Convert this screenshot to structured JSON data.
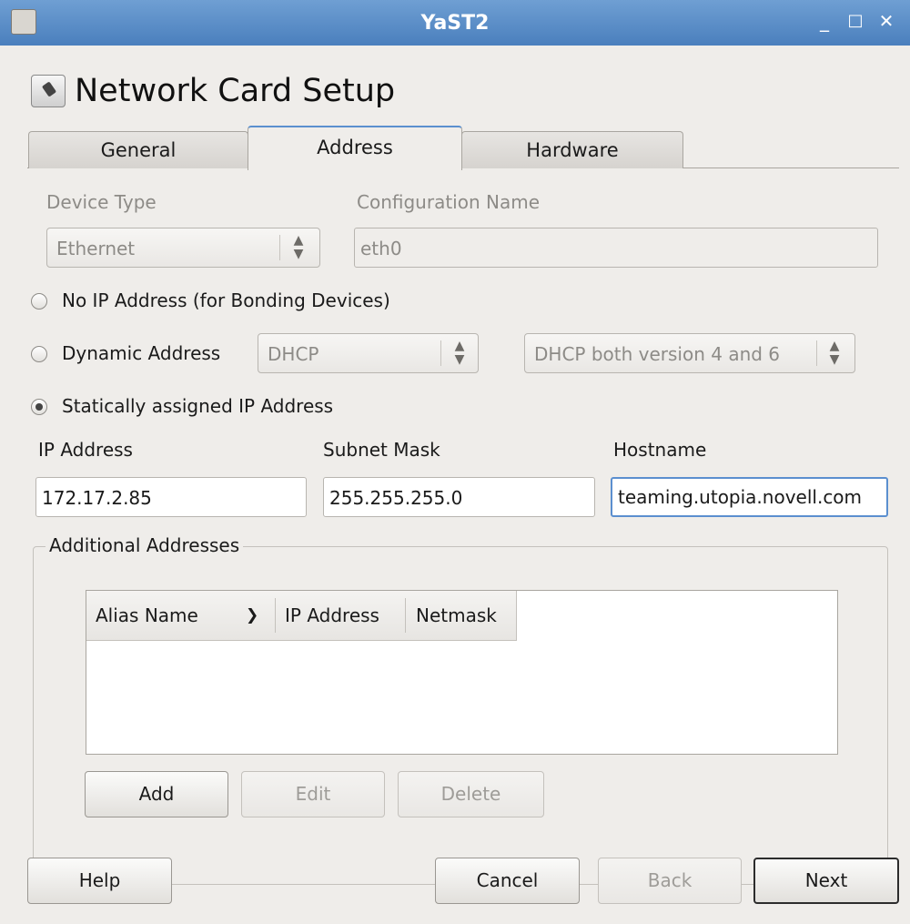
{
  "window": {
    "title": "YaST2",
    "minimize": "_",
    "maximize": "□",
    "close": "✕"
  },
  "page_title": "Network Card Setup",
  "tabs": [
    {
      "label": "General"
    },
    {
      "label": "Address",
      "active": true
    },
    {
      "label": "Hardware"
    }
  ],
  "device": {
    "type_label": "Device Type",
    "type_value": "Ethernet",
    "config_label": "Configuration Name",
    "config_value": "eth0"
  },
  "options": {
    "no_ip_label": "No IP Address (for Bonding Devices)",
    "dynamic_label": "Dynamic Address",
    "dynamic_mode": "DHCP",
    "dynamic_version": "DHCP both version 4 and 6",
    "static_label": "Statically assigned IP Address",
    "selected": "static"
  },
  "static": {
    "ip_label": "IP Address",
    "ip_value": "172.17.2.85",
    "mask_label": "Subnet Mask",
    "mask_value": "255.255.255.0",
    "host_label": "Hostname",
    "host_value": "teaming.utopia.novell.com"
  },
  "additional": {
    "title": "Additional Addresses",
    "columns": [
      "Alias Name",
      "IP Address",
      "Netmask"
    ],
    "sort_icon": "chevron-down-icon",
    "rows": [],
    "add": "Add",
    "edit": "Edit",
    "delete": "Delete"
  },
  "footer": {
    "help": "Help",
    "cancel": "Cancel",
    "back": "Back",
    "next": "Next"
  },
  "colors": {
    "titlebar": "#5a8cc8",
    "background": "#efedea",
    "focus_border": "#5b8fcf"
  }
}
